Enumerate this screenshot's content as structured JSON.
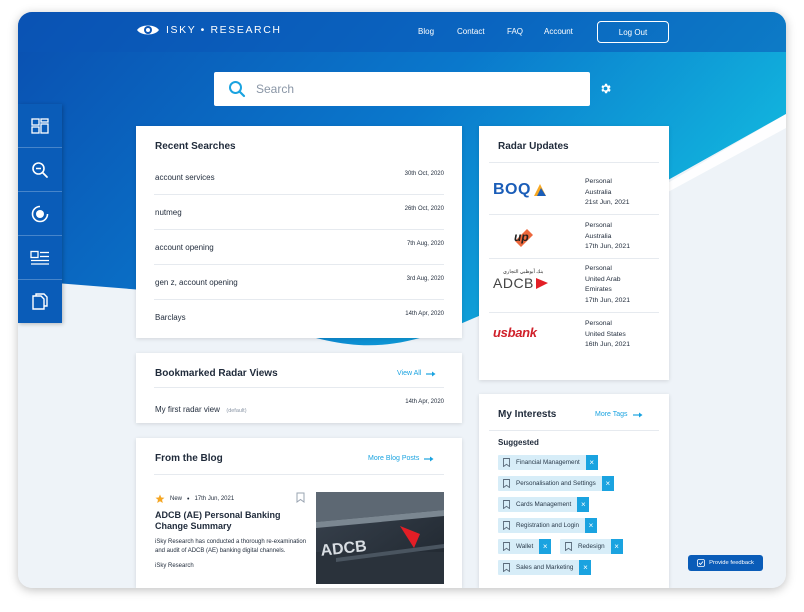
{
  "header": {
    "brand": "ISKY • RESEARCH",
    "nav": [
      "Blog",
      "Contact",
      "FAQ",
      "Account"
    ],
    "logout_label": "Log Out"
  },
  "search": {
    "placeholder": "Search"
  },
  "sidebar": {
    "icons": [
      "dashboard-icon",
      "search-zoom-icon",
      "radar-icon",
      "news-list-icon",
      "documents-icon"
    ]
  },
  "recent_searches": {
    "title": "Recent Searches",
    "items": [
      {
        "query": "account services",
        "date": "30th Oct, 2020"
      },
      {
        "query": "nutmeg",
        "date": "26th Oct, 2020"
      },
      {
        "query": "account opening",
        "date": "7th Aug, 2020"
      },
      {
        "query": "gen z, account opening",
        "date": "3rd Aug, 2020"
      },
      {
        "query": "Barclays",
        "date": "14th Apr, 2020"
      }
    ]
  },
  "bookmarked": {
    "title": "Bookmarked Radar Views",
    "link": "View All",
    "item": {
      "name": "My first radar view",
      "tag": "(default)",
      "date": "14th Apr, 2020"
    }
  },
  "blog": {
    "title": "From the Blog",
    "link": "More Blog Posts",
    "post": {
      "badge": "New",
      "date": "17th Jun, 2021",
      "headline": "ADCB (AE) Personal Banking Change Summary",
      "summary": "iSky Research has conducted a thorough re-examination and audit of ADCB (AE) banking digital channels.",
      "author": "iSky Research"
    }
  },
  "radar": {
    "title": "Radar Updates",
    "items": [
      {
        "logo": "BOQ",
        "type": "Personal",
        "country": "Australia",
        "date": "21st Jun, 2021"
      },
      {
        "logo": "up",
        "type": "Personal",
        "country": "Australia",
        "date": "17th Jun, 2021"
      },
      {
        "logo": "ADCB",
        "logo_sub": "بنك أبوظبي التجاري",
        "type": "Personal",
        "country": "United Arab Emirates",
        "date": "17th Jun, 2021"
      },
      {
        "logo": "usbank",
        "type": "Personal",
        "country": "United States",
        "date": "16th Jun, 2021"
      }
    ]
  },
  "interests": {
    "title": "My Interests",
    "link": "More Tags",
    "suggested_label": "Suggested",
    "tags": [
      "Financial Management",
      "Personalisation and Settings",
      "Cards Management",
      "Registration and Login",
      "Wallet",
      "Redesign",
      "Sales and Marketing"
    ]
  },
  "feedback": {
    "label": "Provide feedback"
  },
  "colors": {
    "primary": "#0a5cb8",
    "accent": "#1aa3e0",
    "red": "#e31e26"
  }
}
